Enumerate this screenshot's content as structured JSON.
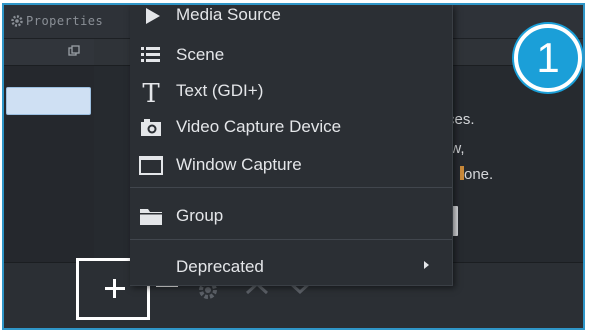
{
  "properties_tab": {
    "label": "Properties",
    "icon": "gear-icon"
  },
  "menu": {
    "items": [
      {
        "label": "Media Source",
        "icon": "play-icon"
      },
      {
        "label": "Scene",
        "icon": "list-icon"
      },
      {
        "label": "Text (GDI+)",
        "icon": "text-icon"
      },
      {
        "label": "Video Capture Device",
        "icon": "camera-icon"
      },
      {
        "label": "Window Capture",
        "icon": "window-icon"
      },
      {
        "label": "Group",
        "icon": "folder-icon"
      },
      {
        "label": "Deprecated",
        "icon": "chevron-right-icon"
      }
    ]
  },
  "background_text": {
    "line1": "rces.",
    "line2": "ow,",
    "line3": "one."
  },
  "step_badge": "1",
  "toolbar": {
    "add": "plus-icon",
    "remove": "minus-icon",
    "settings": "gear-icon",
    "move_up": "chevron-up-icon",
    "move_down": "chevron-down-icon"
  },
  "colors": {
    "accent": "#1b9fd8",
    "menu_bg": "#2b2f34",
    "panel_bg": "#262a2f"
  }
}
